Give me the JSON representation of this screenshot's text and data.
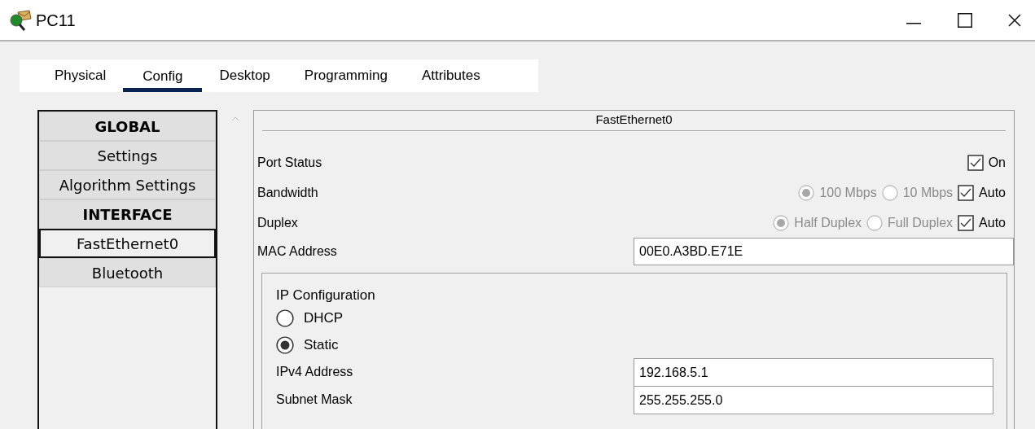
{
  "window": {
    "title": "PC11"
  },
  "tabs": [
    {
      "label": "Physical",
      "selected": false
    },
    {
      "label": "Config",
      "selected": true
    },
    {
      "label": "Desktop",
      "selected": false
    },
    {
      "label": "Programming",
      "selected": false
    },
    {
      "label": "Attributes",
      "selected": false
    }
  ],
  "sidebar": {
    "items": [
      {
        "kind": "header",
        "label": "GLOBAL",
        "selected": false
      },
      {
        "kind": "item",
        "label": "Settings",
        "selected": false
      },
      {
        "kind": "item",
        "label": "Algorithm Settings",
        "selected": false
      },
      {
        "kind": "header",
        "label": "INTERFACE",
        "selected": false
      },
      {
        "kind": "item",
        "label": "FastEthernet0",
        "selected": true
      },
      {
        "kind": "item",
        "label": "Bluetooth",
        "selected": false
      }
    ]
  },
  "panel": {
    "title": "FastEthernet0",
    "port_status": {
      "label": "Port Status",
      "checkbox": {
        "label": "On",
        "checked": true
      }
    },
    "bandwidth": {
      "label": "Bandwidth",
      "options": [
        {
          "label": "100 Mbps",
          "selected": true
        },
        {
          "label": "10 Mbps",
          "selected": false
        }
      ],
      "auto": {
        "label": "Auto",
        "checked": true
      }
    },
    "duplex": {
      "label": "Duplex",
      "options": [
        {
          "label": "Half Duplex",
          "selected": true
        },
        {
          "label": "Full Duplex",
          "selected": false
        }
      ],
      "auto": {
        "label": "Auto",
        "checked": true
      }
    },
    "mac_address": {
      "label": "MAC Address",
      "value": "00E0.A3BD.E71E"
    },
    "ip_configuration": {
      "title": "IP Configuration",
      "modes": [
        {
          "label": "DHCP",
          "selected": false
        },
        {
          "label": "Static",
          "selected": true
        }
      ],
      "fields": [
        {
          "label": "IPv4 Address",
          "value": "192.168.5.1"
        },
        {
          "label": "Subnet Mask",
          "value": "255.255.255.0"
        }
      ]
    }
  }
}
